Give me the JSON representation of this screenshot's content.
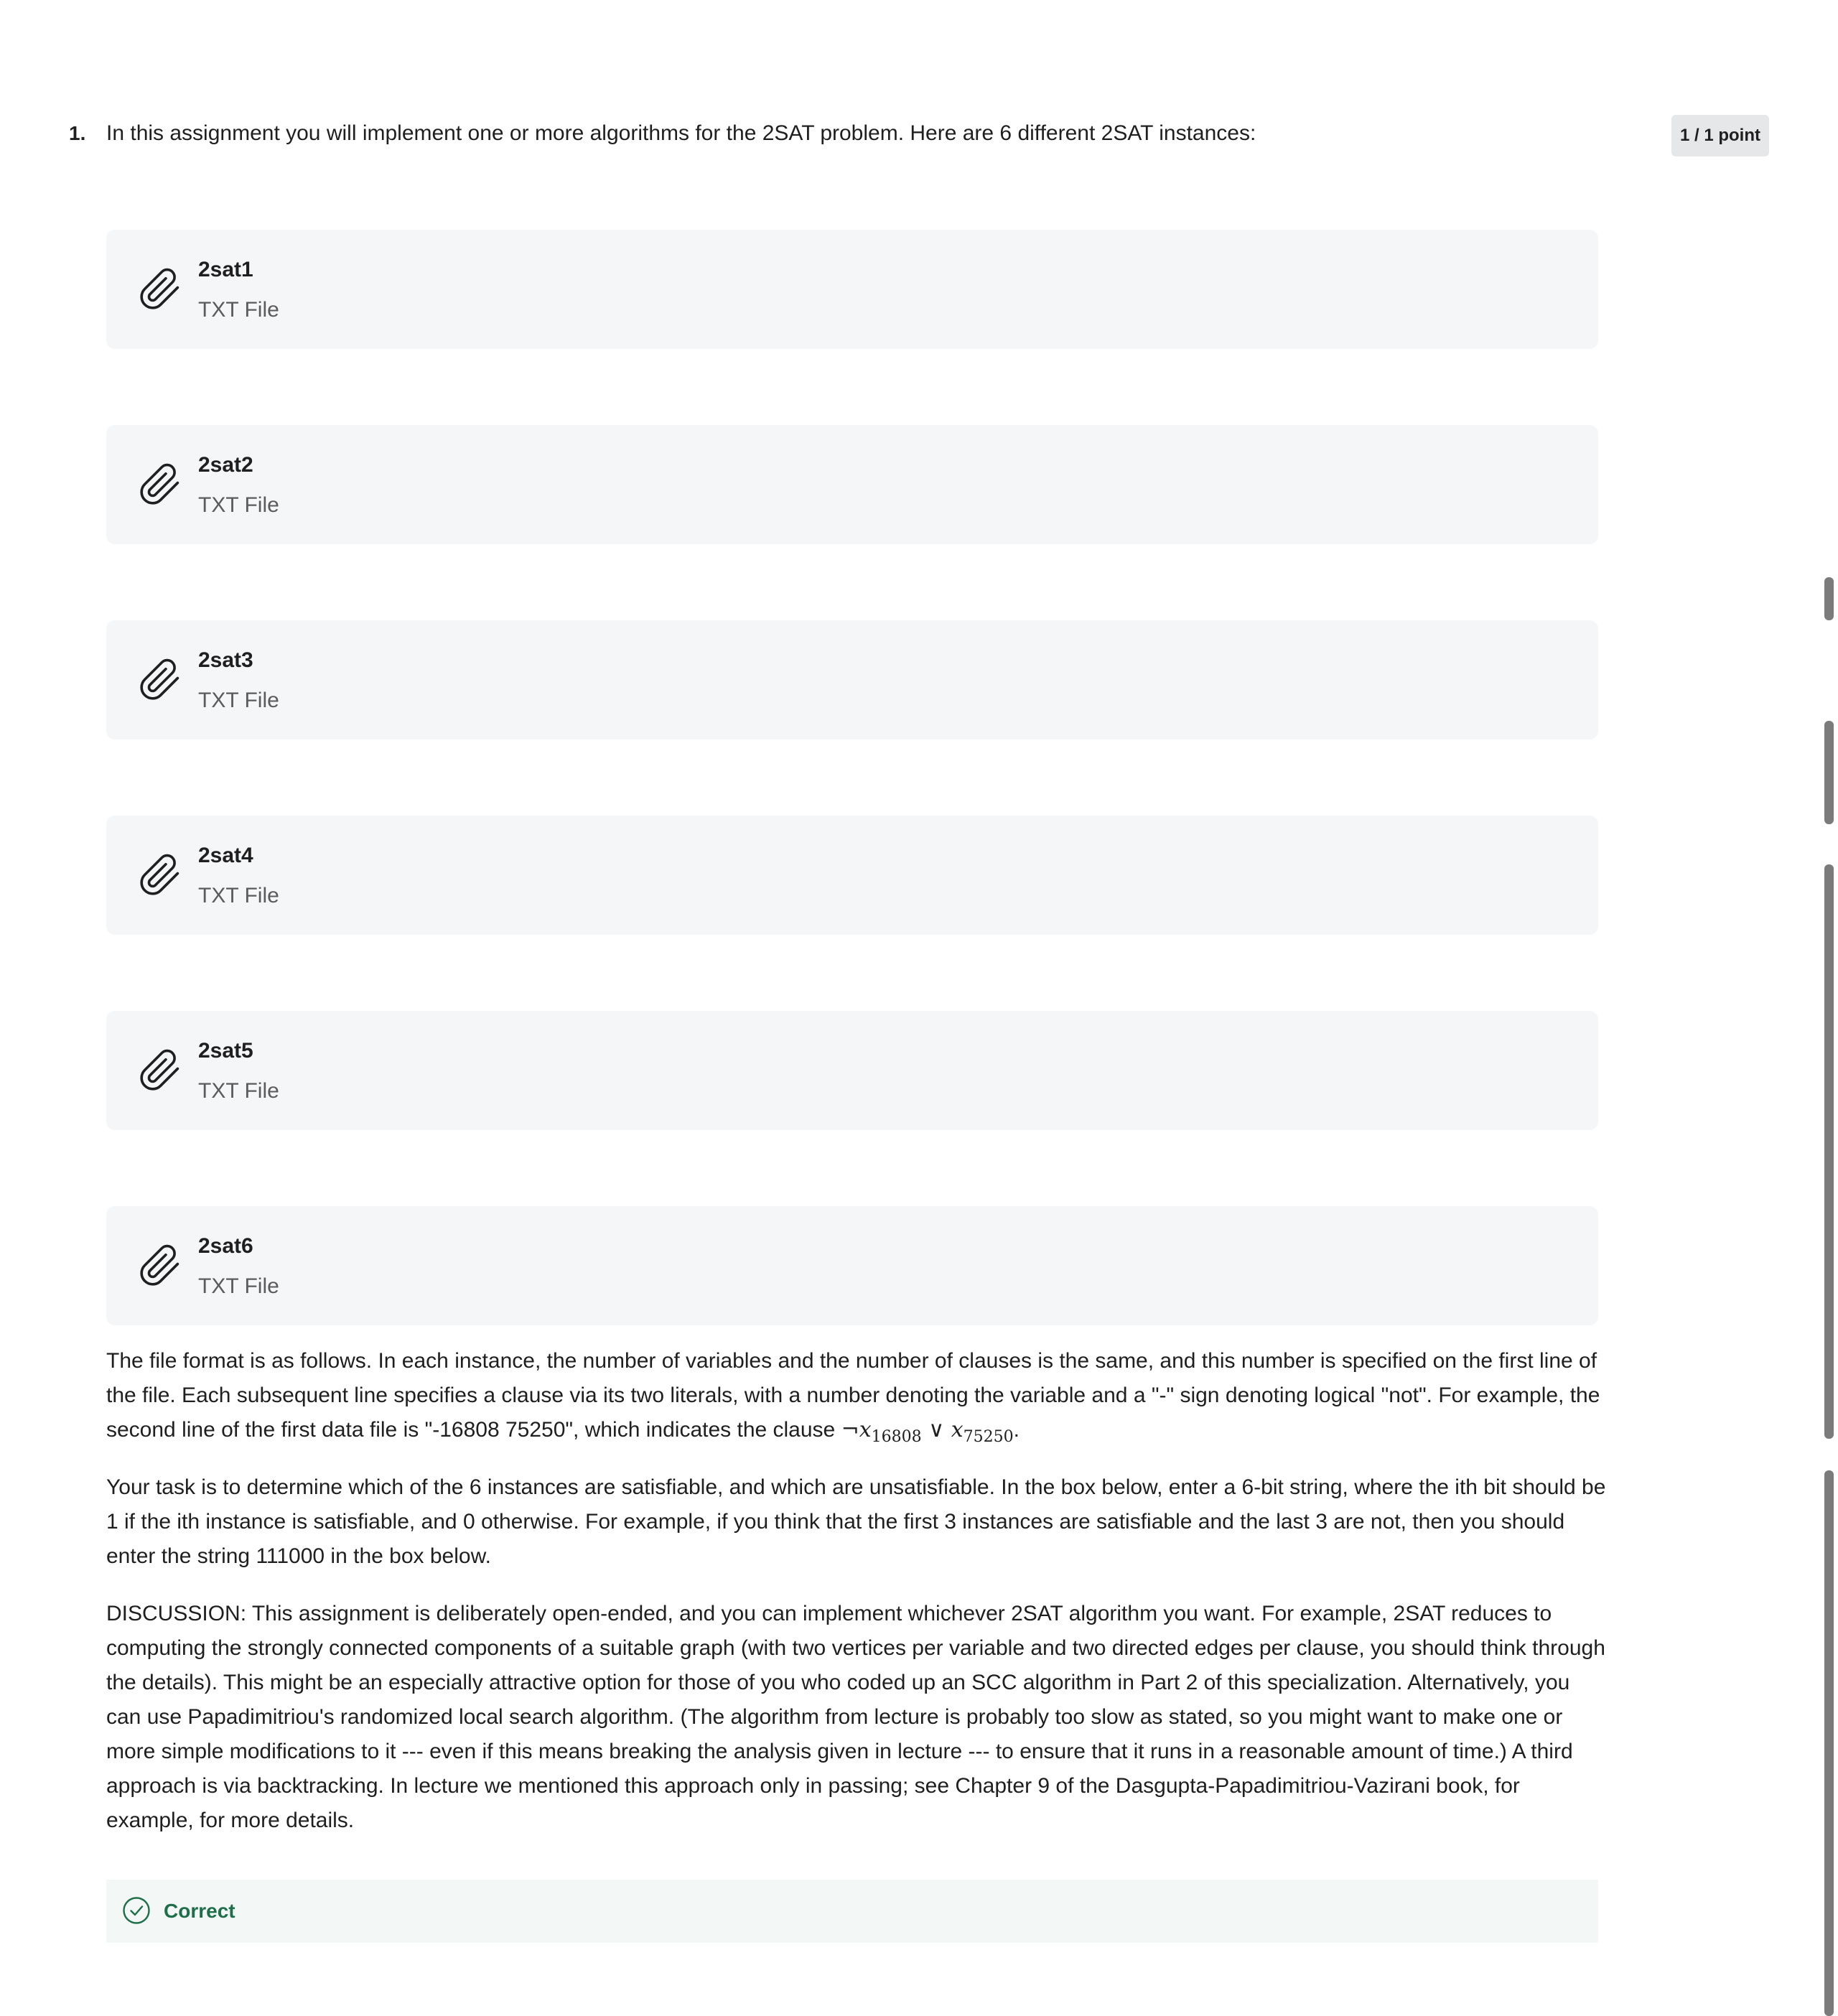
{
  "question": {
    "number": "1.",
    "prompt": "In this assignment you will implement one or more algorithms for the 2SAT problem.  Here are 6 different 2SAT instances:",
    "points": "1 / 1 point"
  },
  "attachments": [
    {
      "name": "2sat1",
      "type": "TXT File",
      "icon": "paperclip-icon"
    },
    {
      "name": "2sat2",
      "type": "TXT File",
      "icon": "paperclip-icon"
    },
    {
      "name": "2sat3",
      "type": "TXT File",
      "icon": "paperclip-icon"
    },
    {
      "name": "2sat4",
      "type": "TXT File",
      "icon": "paperclip-icon"
    },
    {
      "name": "2sat5",
      "type": "TXT File",
      "icon": "paperclip-icon"
    },
    {
      "name": "2sat6",
      "type": "TXT File",
      "icon": "paperclip-icon"
    }
  ],
  "paragraphs": {
    "file_format_text": "The file format is as follows.  In each instance, the number of variables and the number of clauses is the same, and this number is specified on the first line of the file.  Each subsequent line specifies a clause via its two literals, with a number denoting the variable and a \"-\" sign denoting logical \"not\".  For example, the second line of the first data file is \"-16808 75250\", which indicates the clause ",
    "clause_math": {
      "not": "¬",
      "var1": "x",
      "sub1": "16808",
      "or": "∨",
      "var2": "x",
      "sub2": "75250",
      "end": "."
    },
    "task": "Your task is to determine which of the 6 instances are satisfiable, and which are unsatisfiable.  In the box below, enter a 6-bit string, where the ith bit should be 1 if the ith instance is satisfiable, and 0 otherwise.  For example, if you think that the first 3 instances are satisfiable and the last 3 are not, then you should enter the string 111000 in the box below.",
    "discussion": "DISCUSSION: This assignment is deliberately open-ended, and you can implement whichever 2SAT algorithm you want.  For example, 2SAT reduces to computing the strongly connected components of a suitable graph (with two vertices per variable and two directed edges per clause, you should think through the details).  This might be an especially attractive option for those of you who coded up an SCC algorithm in Part 2 of this specialization.  Alternatively, you can use Papadimitriou's randomized local search algorithm.  (The algorithm from lecture is probably too slow as stated, so you might want to make one or more simple modifications to it --- even if this means breaking the analysis given in lecture --- to ensure that it runs in a reasonable amount of time.)  A third approach is via backtracking.  In lecture we mentioned this approach only in passing; see Chapter 9 of the Dasgupta-Papadimitriou-Vazirani book, for example, for more details."
  },
  "feedback": {
    "label": "Correct",
    "icon": "check-circle-icon",
    "color": "#1e6e4a"
  }
}
